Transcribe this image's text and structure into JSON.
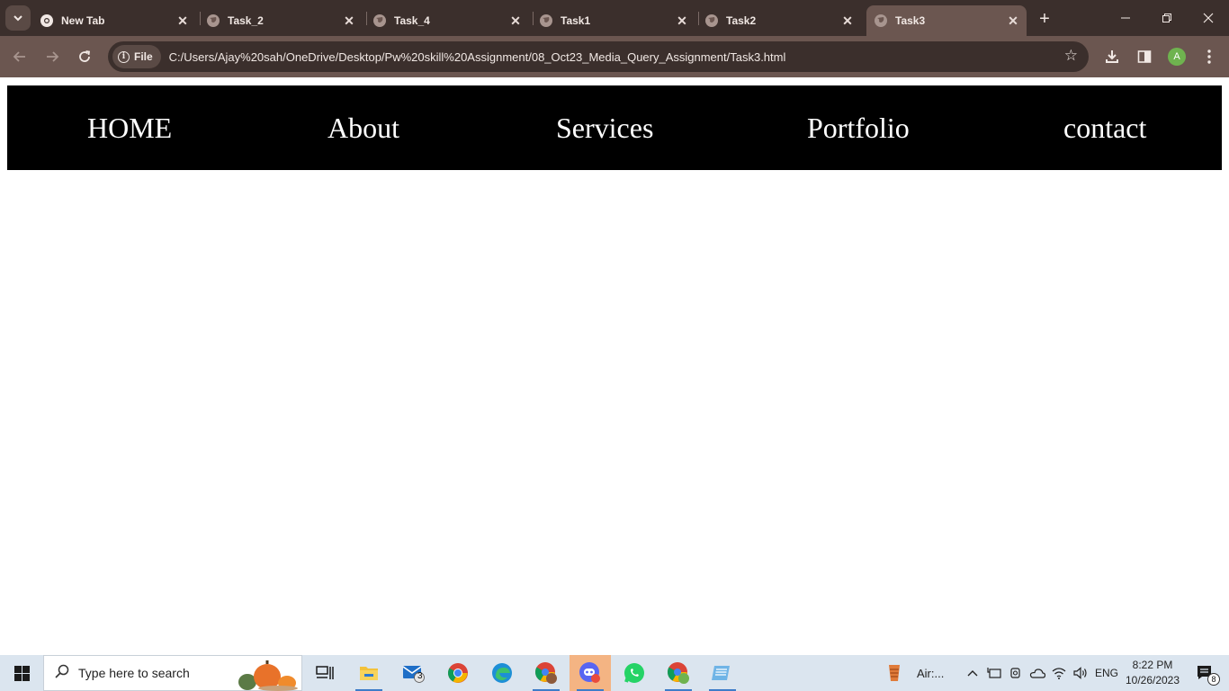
{
  "browser": {
    "tabs": [
      {
        "title": "New Tab",
        "icon": "chrome-icon",
        "active": false
      },
      {
        "title": "Task_2",
        "icon": "globe-icon",
        "active": false
      },
      {
        "title": "Task_4",
        "icon": "globe-icon",
        "active": false
      },
      {
        "title": "Task1",
        "icon": "globe-icon",
        "active": false
      },
      {
        "title": "Task2",
        "icon": "globe-icon",
        "active": false
      },
      {
        "title": "Task3",
        "icon": "globe-icon",
        "active": true
      }
    ],
    "address": {
      "scheme_chip": "File",
      "url": "C:/Users/Ajay%20sah/OneDrive/Desktop/Pw%20skill%20Assignment/08_Oct23_Media_Query_Assignment/Task3.html"
    },
    "profile_initial": "A",
    "colors": {
      "frame": "#3b2f2c",
      "toolbar": "#6b5650",
      "profile": "#6fb34f"
    }
  },
  "page": {
    "nav": {
      "items": [
        "HOME",
        "About",
        "Services",
        "Portfolio",
        "contact"
      ],
      "background": "#000000",
      "text_color": "#ffffff"
    }
  },
  "taskbar": {
    "search_placeholder": "Type here to search",
    "mail_badge": "3",
    "weather_label": "Air:...",
    "language": "ENG",
    "time": "8:22 PM",
    "date": "10/26/2023",
    "notification_count": "8",
    "apps": [
      "task-view-icon",
      "file-explorer-icon",
      "mail-icon",
      "chrome-icon",
      "edge-icon",
      "chrome-profile-icon",
      "discord-icon",
      "whatsapp-icon",
      "chrome-profile-a-icon",
      "notepad-icon"
    ]
  }
}
